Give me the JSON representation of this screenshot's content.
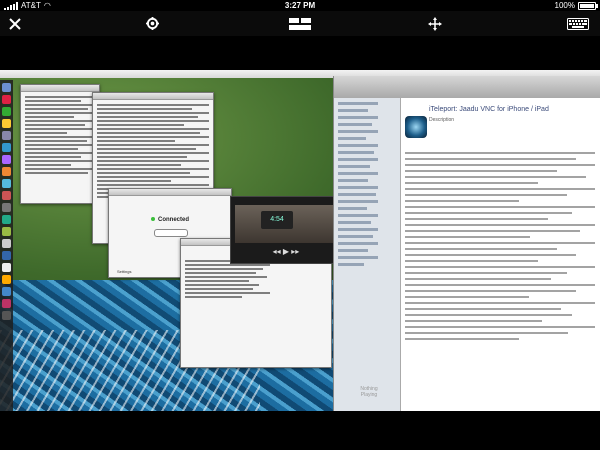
{
  "status_bar": {
    "carrier": "AT&T",
    "time": "3:27 PM",
    "battery": "100%"
  },
  "toolbar": {
    "close_icon": "close-icon",
    "settings_icon": "gear-icon",
    "keyboard_icon": "keyboard-icon",
    "move_icon": "move-arrows-icon",
    "grid_icon": "screens-icon"
  },
  "remote_screen": {
    "connected_label": "Connected",
    "settings_label": "Settings",
    "itunes_title": "iTeleport: Jaadu VNC for iPhone / iPad",
    "itunes_subtitle": "Description",
    "nothing_playing": "Nothing\nPlaying",
    "video_time": "4:54"
  }
}
